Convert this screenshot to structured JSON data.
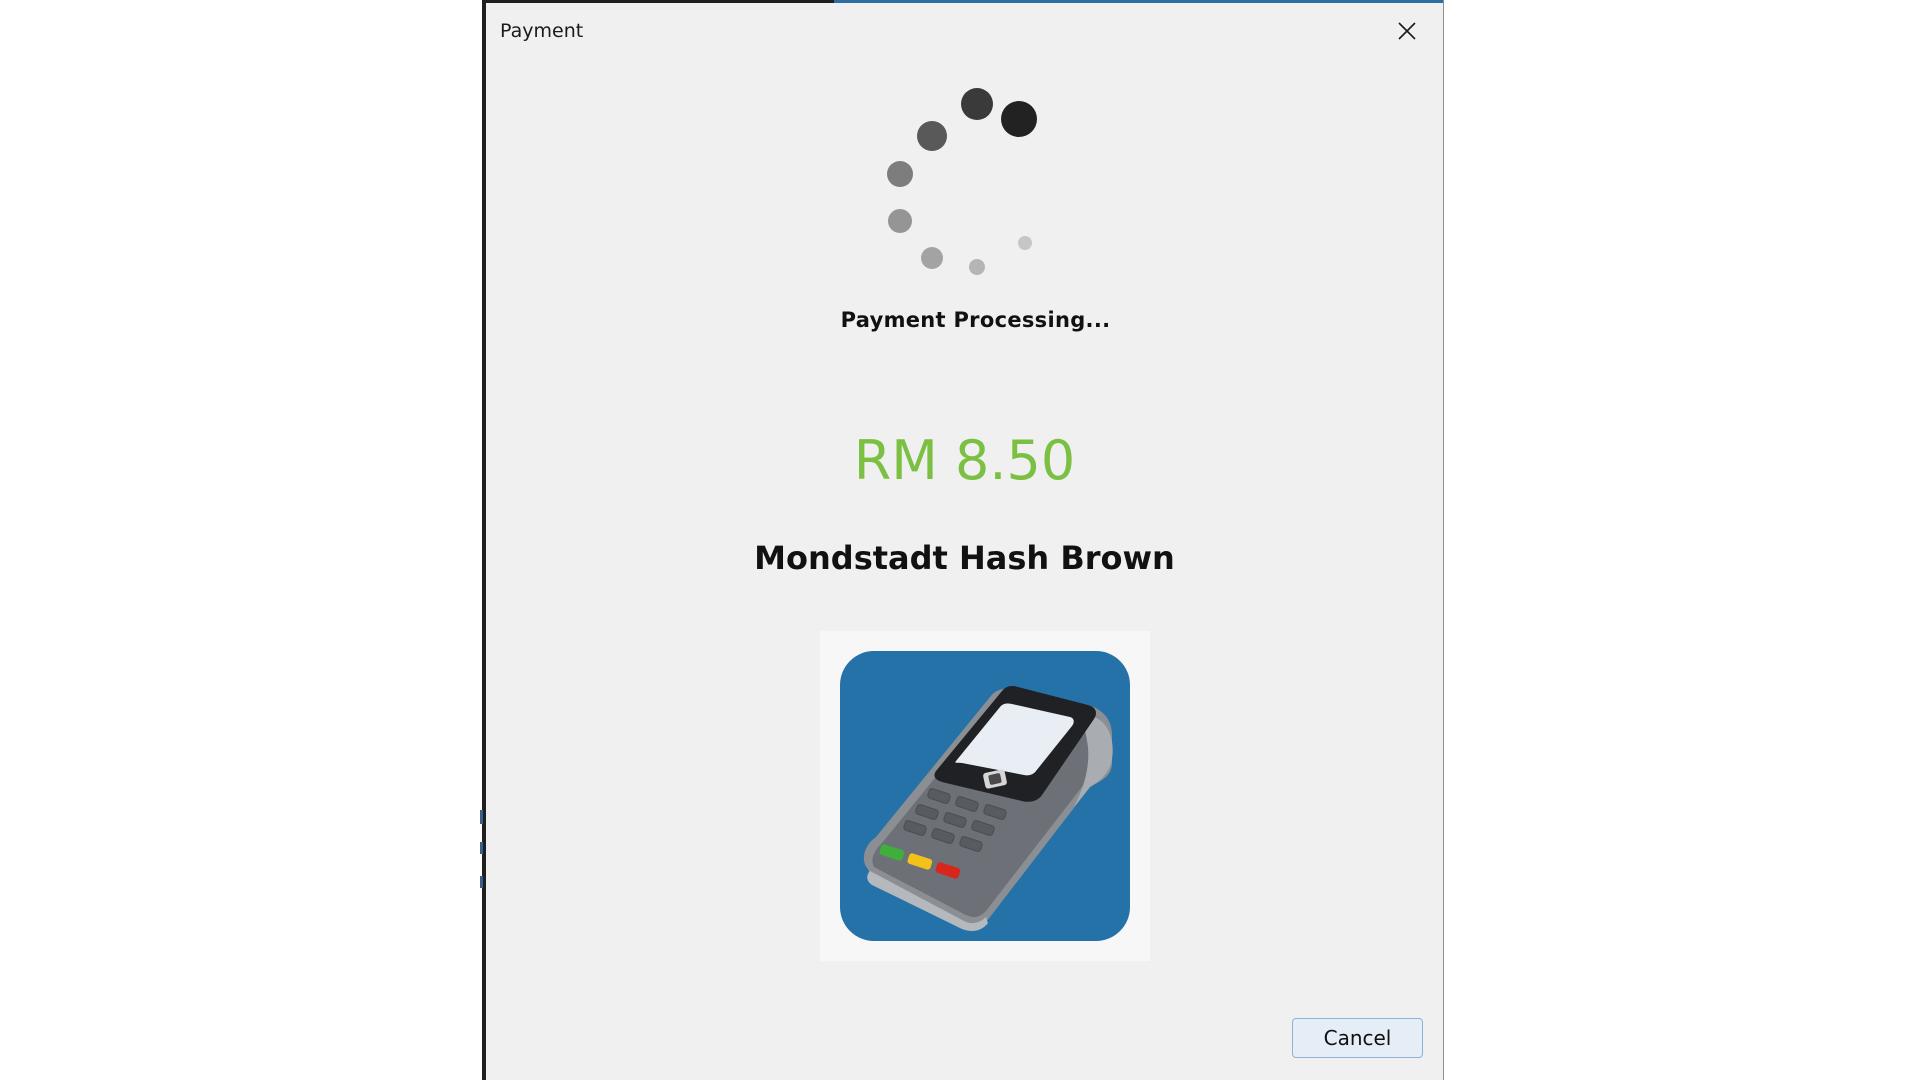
{
  "window": {
    "title": "Payment",
    "close_icon": "close-icon"
  },
  "payment": {
    "spinner_icon": "loading-spinner-icon",
    "status": "Payment Processing...",
    "amount": "RM 8.50",
    "product_name": "Mondstadt Hash Brown",
    "terminal_icon": "card-terminal-icon"
  },
  "actions": {
    "cancel_label": "Cancel"
  },
  "colors": {
    "window_bg": "#f0f0f0",
    "amount_green": "#7cc043",
    "terminal_tile_blue": "#2472a8",
    "button_bg": "#e5edf6",
    "button_border": "#8fb3d8"
  }
}
